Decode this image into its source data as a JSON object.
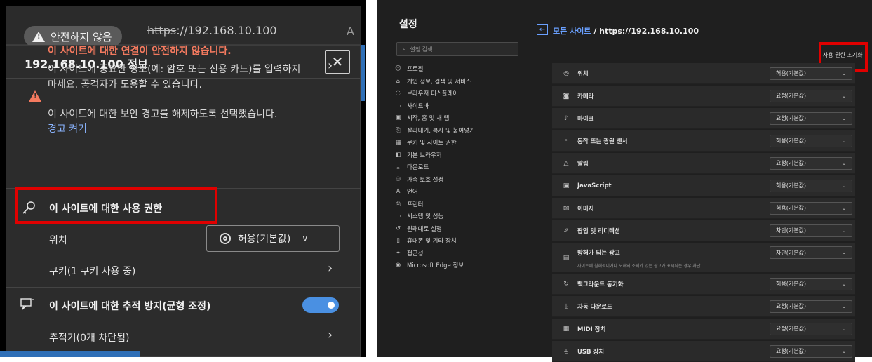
{
  "left": {
    "address": {
      "security_label": "안전하지 않음",
      "url_scheme": "https",
      "url_rest": "://192.168.10.100",
      "reader_glyph": "A"
    },
    "flyout": {
      "title": "192.168.10.100 정보",
      "close_glyph": "✕",
      "warning_title": "이 사이트에 대한 연결이 안전하지 않습니다.",
      "warning_body": "이 사이트에 중요한 정보(예: 암호 또는 신용 카드)를 입력하지 마세요. 공격자가 도용할 수 있습니다.",
      "cert_text": "이 사이트에 대한 보안 경고를 해제하도록 선택했습니다.",
      "cert_link": "경고 켜기",
      "permissions_title": "이 사이트에 대한 사용 권한",
      "location_label": "위치",
      "location_value": "허용(기본값)",
      "cookie_label": "쿠키(1 쿠키 사용 중)",
      "tracking_title": "이 사이트에 대한 추적 방지(균형 조정)",
      "tracking_enabled": true,
      "tracker_label": "추적기(0개 차단됨)",
      "chevron": "›"
    }
  },
  "right": {
    "settings_title": "설정",
    "search_placeholder": "설정 검색",
    "nav": [
      {
        "icon": "profile-icon",
        "glyph": "☺",
        "label": "프로필"
      },
      {
        "icon": "lock-icon",
        "glyph": "⌂",
        "label": "개인 정보, 검색 및 서비스"
      },
      {
        "icon": "palette-icon",
        "glyph": "◌",
        "label": "브라우저 디스플레이"
      },
      {
        "icon": "sidebar-icon",
        "glyph": "▭",
        "label": "사이드바"
      },
      {
        "icon": "home-icon",
        "glyph": "▣",
        "label": "시작, 홈 및 새 탭"
      },
      {
        "icon": "clipboard-icon",
        "glyph": "⎘",
        "label": "잘라내기, 복사 및 붙여넣기"
      },
      {
        "icon": "cookie-icon",
        "glyph": "▦",
        "label": "쿠키 및 사이트 권한"
      },
      {
        "icon": "browser-icon",
        "glyph": "◧",
        "label": "기본 브라우저"
      },
      {
        "icon": "download-icon",
        "glyph": "⤓",
        "label": "다운로드"
      },
      {
        "icon": "family-icon",
        "glyph": "⚇",
        "label": "가족 보호 설정"
      },
      {
        "icon": "language-icon",
        "glyph": "A",
        "label": "언어"
      },
      {
        "icon": "printer-icon",
        "glyph": "⎙",
        "label": "프린터"
      },
      {
        "icon": "system-icon",
        "glyph": "▭",
        "label": "시스템 및 성능"
      },
      {
        "icon": "reset-icon",
        "glyph": "↺",
        "label": "원래대로 설정"
      },
      {
        "icon": "phone-icon",
        "glyph": "▯",
        "label": "휴대폰 및 기타 장치"
      },
      {
        "icon": "accessibility-icon",
        "glyph": "✦",
        "label": "접근성"
      },
      {
        "icon": "edge-icon",
        "glyph": "◉",
        "label": "Microsoft Edge 정보"
      }
    ],
    "breadcrumb_link": "모든 사이트",
    "breadcrumb_rest": " / https://192.168.10.100",
    "reset_label": "사용 권한 초기화",
    "permissions": [
      {
        "icon": "location-icon",
        "glyph": "◎",
        "label": "위치",
        "value": "허용(기본값)"
      },
      {
        "icon": "camera-icon",
        "glyph": "◙",
        "label": "카메라",
        "value": "요청(기본값)"
      },
      {
        "icon": "mic-icon",
        "glyph": "♪",
        "label": "마이크",
        "value": "요청(기본값)"
      },
      {
        "icon": "motion-sensor-icon",
        "glyph": "◦",
        "label": "동작 또는 광원 센서",
        "value": "허용(기본값)"
      },
      {
        "icon": "bell-icon",
        "glyph": "△",
        "label": "알림",
        "value": "요청(기본값)"
      },
      {
        "icon": "javascript-icon",
        "glyph": "▣",
        "label": "JavaScript",
        "value": "허용(기본값)"
      },
      {
        "icon": "image-icon",
        "glyph": "▨",
        "label": "이미지",
        "value": "허용(기본값)"
      },
      {
        "icon": "popup-icon",
        "glyph": "⇗",
        "label": "팝업 및 리디렉션",
        "value": "차단(기본값)"
      },
      {
        "icon": "ads-icon",
        "glyph": "▤",
        "label": "방해가 되는 광고",
        "sub": "사이트에 침해적이거나 오해의 소지가 있는 광고가 표시되는 경우 차단",
        "value": "차단(기본값)"
      },
      {
        "icon": "sync-icon",
        "glyph": "↻",
        "label": "백그라운드 동기화",
        "value": "허용(기본값)"
      },
      {
        "icon": "auto-download-icon",
        "glyph": "⤓",
        "label": "자동 다운로드",
        "value": "요청(기본값)"
      },
      {
        "icon": "midi-icon",
        "glyph": "▦",
        "label": "MIDI 장치",
        "value": "요청(기본값)"
      },
      {
        "icon": "usb-icon",
        "glyph": "⏚",
        "label": "USB 장치",
        "value": "요청(기본값)"
      }
    ],
    "dropdown_glyph": "⌄"
  }
}
